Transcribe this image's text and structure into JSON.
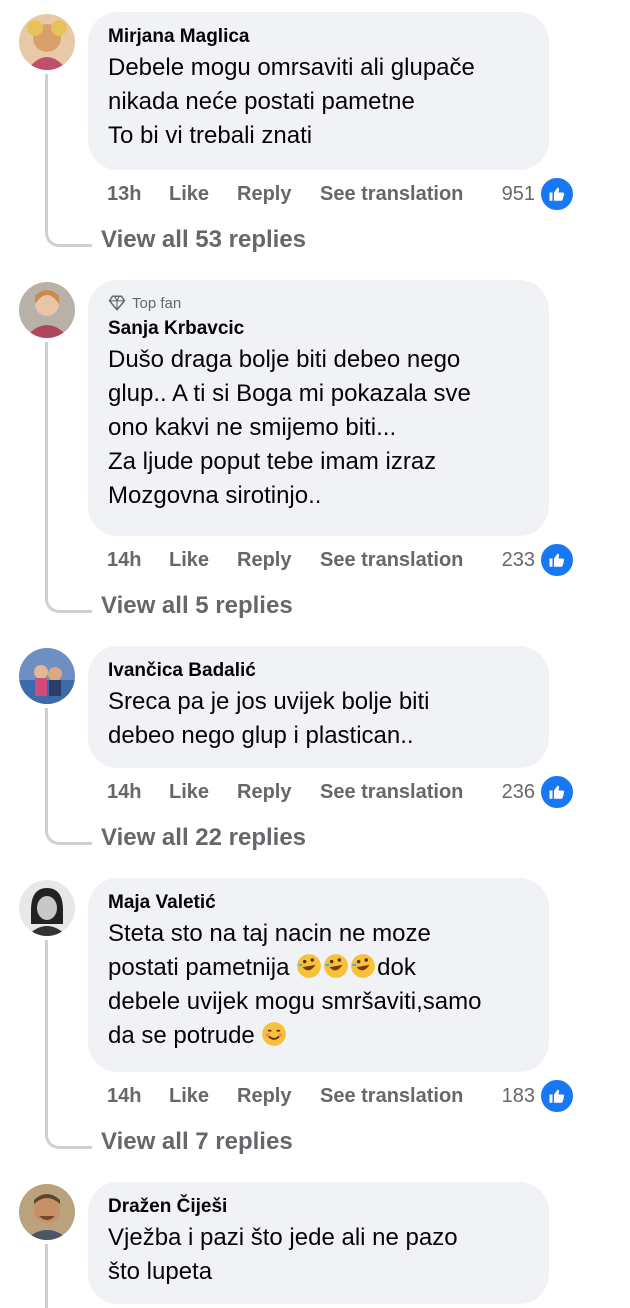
{
  "comments": [
    {
      "author": "Mirjana Maglica",
      "top_fan": false,
      "text": "Debele mogu omrsaviti ali glupače\nnikada neće postati pametne\nTo bi vi trebali znati",
      "time": "13h",
      "like": "Like",
      "reply": "Reply",
      "translate": "See translation",
      "count": "951",
      "view_all": "View all 53 replies"
    },
    {
      "author": "Sanja Krbavcic",
      "top_fan": true,
      "top_fan_label": "Top fan",
      "text": "Dušo draga bolje biti debeo nego\nglup.. A ti si Boga mi pokazala sve\nono kakvi ne smijemo biti...\nZa ljude poput tebe imam izraz\nMozgovna sirotinjo..",
      "time": "14h",
      "like": "Like",
      "reply": "Reply",
      "translate": "See translation",
      "count": "233",
      "view_all": "View all 5 replies"
    },
    {
      "author": "Ivančica Badalić",
      "top_fan": false,
      "text": "Sreca pa je jos uvijek bolje biti\ndebeo nego glup i plastican..",
      "time": "14h",
      "like": "Like",
      "reply": "Reply",
      "translate": "See translation",
      "count": "236",
      "view_all": "View all 22 replies"
    },
    {
      "author": "Maja Valetić",
      "top_fan": false,
      "text_lines": [
        "Steta sto na taj nacin ne moze",
        "postati pametnija",
        "dok",
        "debele uvijek mogu smršaviti,samo",
        "da se potrude"
      ],
      "time": "14h",
      "like": "Like",
      "reply": "Reply",
      "translate": "See translation",
      "count": "183",
      "view_all": "View all 7 replies"
    },
    {
      "author": "Dražen Čiješi",
      "top_fan": false,
      "text": "Vježba i pazi što jede ali ne pazo\nšto lupeta"
    }
  ],
  "colors": {
    "bubble": "#f0f2f5",
    "meta": "#65676b",
    "like_blue": "#1877f2",
    "thread_line": "#ced0d4"
  },
  "icons": {
    "reaction": "thumbs-up-icon",
    "top_fan": "diamond-icon",
    "laugh": "rofl-emoji",
    "smile": "smiling-emoji"
  }
}
